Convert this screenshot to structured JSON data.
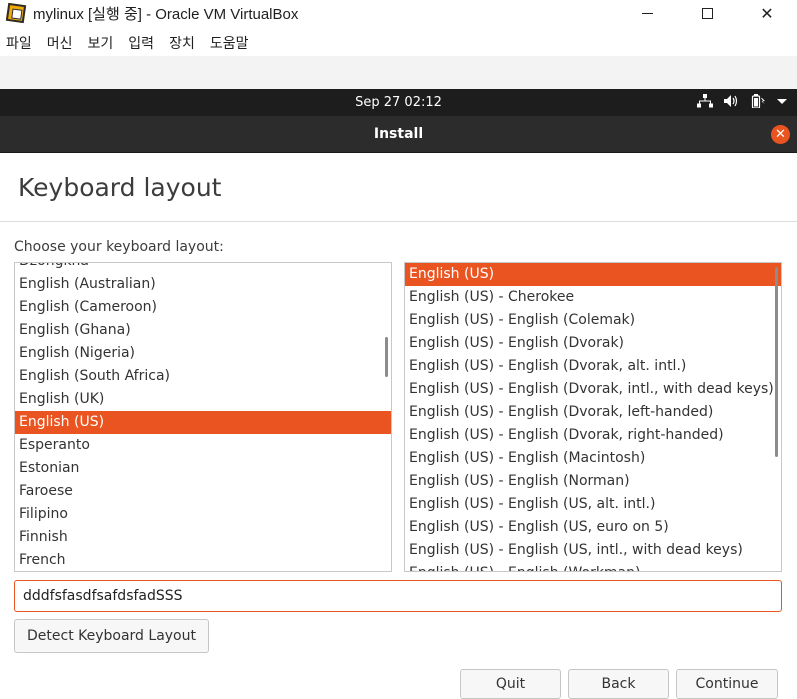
{
  "window": {
    "title": "mylinux [실행 중] - Oracle VM VirtualBox",
    "controls": {
      "minimize": "minimize-icon",
      "maximize": "maximize-icon",
      "close": "✕"
    }
  },
  "menubar": [
    "파일",
    "머신",
    "보기",
    "입력",
    "장치",
    "도움말"
  ],
  "topbar": {
    "clock": "Sep 27  02:12"
  },
  "installer": {
    "header_title": "Install",
    "close_glyph": "✕",
    "page_title": "Keyboard layout",
    "choose_label": "Choose your keyboard layout:",
    "layouts": [
      "Dzongkha",
      "English (Australian)",
      "English (Cameroon)",
      "English (Ghana)",
      "English (Nigeria)",
      "English (South Africa)",
      "English (UK)",
      "English (US)",
      "Esperanto",
      "Estonian",
      "Faroese",
      "Filipino",
      "Finnish",
      "French"
    ],
    "selected_layout": "English (US)",
    "variants": [
      "English (US)",
      "English (US) - Cherokee",
      "English (US) - English (Colemak)",
      "English (US) - English (Dvorak)",
      "English (US) - English (Dvorak, alt. intl.)",
      "English (US) - English (Dvorak, intl., with dead keys)",
      "English (US) - English (Dvorak, left-handed)",
      "English (US) - English (Dvorak, right-handed)",
      "English (US) - English (Macintosh)",
      "English (US) - English (Norman)",
      "English (US) - English (US, alt. intl.)",
      "English (US) - English (US, euro on 5)",
      "English (US) - English (US, intl., with dead keys)",
      "English (US) - English (Workman)"
    ],
    "selected_variant": "English (US)",
    "test_input_value": "dddfsfasdfsafdsfadSSS",
    "detect_button": "Detect Keyboard Layout",
    "quit_button": "Quit",
    "back_button": "Back",
    "continue_button": "Continue"
  },
  "colors": {
    "accent": "#e95420",
    "topbar": "#1d1d1d",
    "header": "#2c2c2c"
  }
}
